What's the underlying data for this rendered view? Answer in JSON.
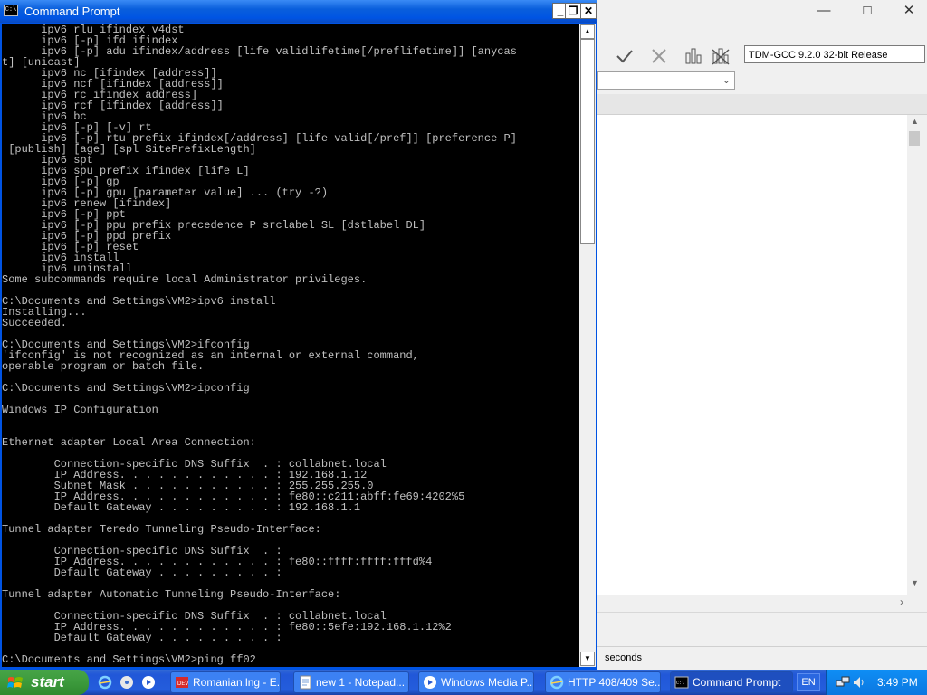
{
  "ide": {
    "compiler_label": "TDM-GCC 9.2.0 32-bit Release",
    "status_text": "seconds"
  },
  "cmd": {
    "title": "Command Prompt",
    "lines": [
      "      ipv6 rlu ifindex v4dst",
      "      ipv6 [-p] ifd ifindex",
      "      ipv6 [-p] adu ifindex/address [life validlifetime[/preflifetime]] [anycas",
      "t] [unicast]",
      "      ipv6 nc [ifindex [address]]",
      "      ipv6 ncf [ifindex [address]]",
      "      ipv6 rc ifindex address]",
      "      ipv6 rcf [ifindex [address]]",
      "      ipv6 bc",
      "      ipv6 [-p] [-v] rt",
      "      ipv6 [-p] rtu prefix ifindex[/address] [life valid[/pref]] [preference P]",
      " [publish] [age] [spl SitePrefixLength]",
      "      ipv6 spt",
      "      ipv6 spu prefix ifindex [life L]",
      "      ipv6 [-p] gp",
      "      ipv6 [-p] gpu [parameter value] ... (try -?)",
      "      ipv6 renew [ifindex]",
      "      ipv6 [-p] ppt",
      "      ipv6 [-p] ppu prefix precedence P srclabel SL [dstlabel DL]",
      "      ipv6 [-p] ppd prefix",
      "      ipv6 [-p] reset",
      "      ipv6 install",
      "      ipv6 uninstall",
      "Some subcommands require local Administrator privileges.",
      "",
      "C:\\Documents and Settings\\VM2>ipv6 install",
      "Installing...",
      "Succeeded.",
      "",
      "C:\\Documents and Settings\\VM2>ifconfig",
      "'ifconfig' is not recognized as an internal or external command,",
      "operable program or batch file.",
      "",
      "C:\\Documents and Settings\\VM2>ipconfig",
      "",
      "Windows IP Configuration",
      "",
      "",
      "Ethernet adapter Local Area Connection:",
      "",
      "        Connection-specific DNS Suffix  . : collabnet.local",
      "        IP Address. . . . . . . . . . . . : 192.168.1.12",
      "        Subnet Mask . . . . . . . . . . . : 255.255.255.0",
      "        IP Address. . . . . . . . . . . . : fe80::c211:abff:fe69:4202%5",
      "        Default Gateway . . . . . . . . . : 192.168.1.1",
      "",
      "Tunnel adapter Teredo Tunneling Pseudo-Interface:",
      "",
      "        Connection-specific DNS Suffix  . :",
      "        IP Address. . . . . . . . . . . . : fe80::ffff:ffff:fffd%4",
      "        Default Gateway . . . . . . . . . :",
      "",
      "Tunnel adapter Automatic Tunneling Pseudo-Interface:",
      "",
      "        Connection-specific DNS Suffix  . : collabnet.local",
      "        IP Address. . . . . . . . . . . . : fe80::5efe:192.168.1.12%2",
      "        Default Gateway . . . . . . . . . :",
      "",
      "C:\\Documents and Settings\\VM2>ping ff02"
    ]
  },
  "taskbar": {
    "start_label": "start",
    "tasks": [
      {
        "label": "Romanian.lng - E...",
        "icon": "editor-icon"
      },
      {
        "label": "new 1 - Notepad...",
        "icon": "notepad-icon"
      },
      {
        "label": "Windows Media P...",
        "icon": "media-player-icon"
      },
      {
        "label": "HTTP 408/409 Se...",
        "icon": "ie-icon"
      },
      {
        "label": "Command Prompt",
        "icon": "cmd-icon"
      }
    ],
    "language": "EN",
    "clock": "3:49 PM"
  },
  "colors": {
    "console_bg": "#000000",
    "console_fg": "#c0c0c0",
    "titlebar_blue": "#0054e3",
    "start_green": "#3c9a3c"
  }
}
